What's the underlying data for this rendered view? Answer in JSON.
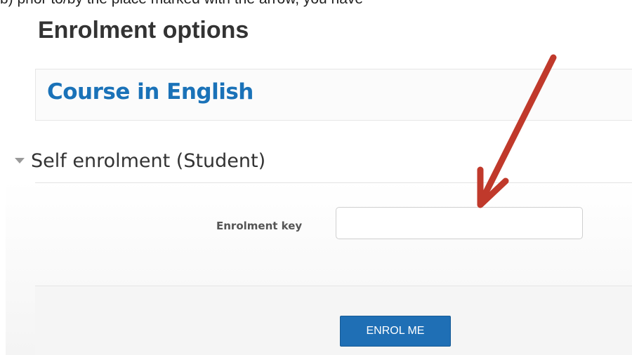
{
  "page": {
    "title": "Enrolment options",
    "caption_fragment": "b) prior to/by the place marked with the arrow, you have"
  },
  "course": {
    "name": "Course in English"
  },
  "enrolment_section": {
    "title": "Self enrolment (Student)",
    "toggle_icon": "chevron-down-icon",
    "key_field": {
      "label": "Enrolment key",
      "value": "",
      "placeholder": ""
    },
    "submit_label": "ENROL ME"
  },
  "annotation": {
    "arrow_color": "#c0392b"
  },
  "colors": {
    "title_text": "#333333",
    "course_link": "#1a72b8",
    "button_bg": "#1f6fb5"
  }
}
